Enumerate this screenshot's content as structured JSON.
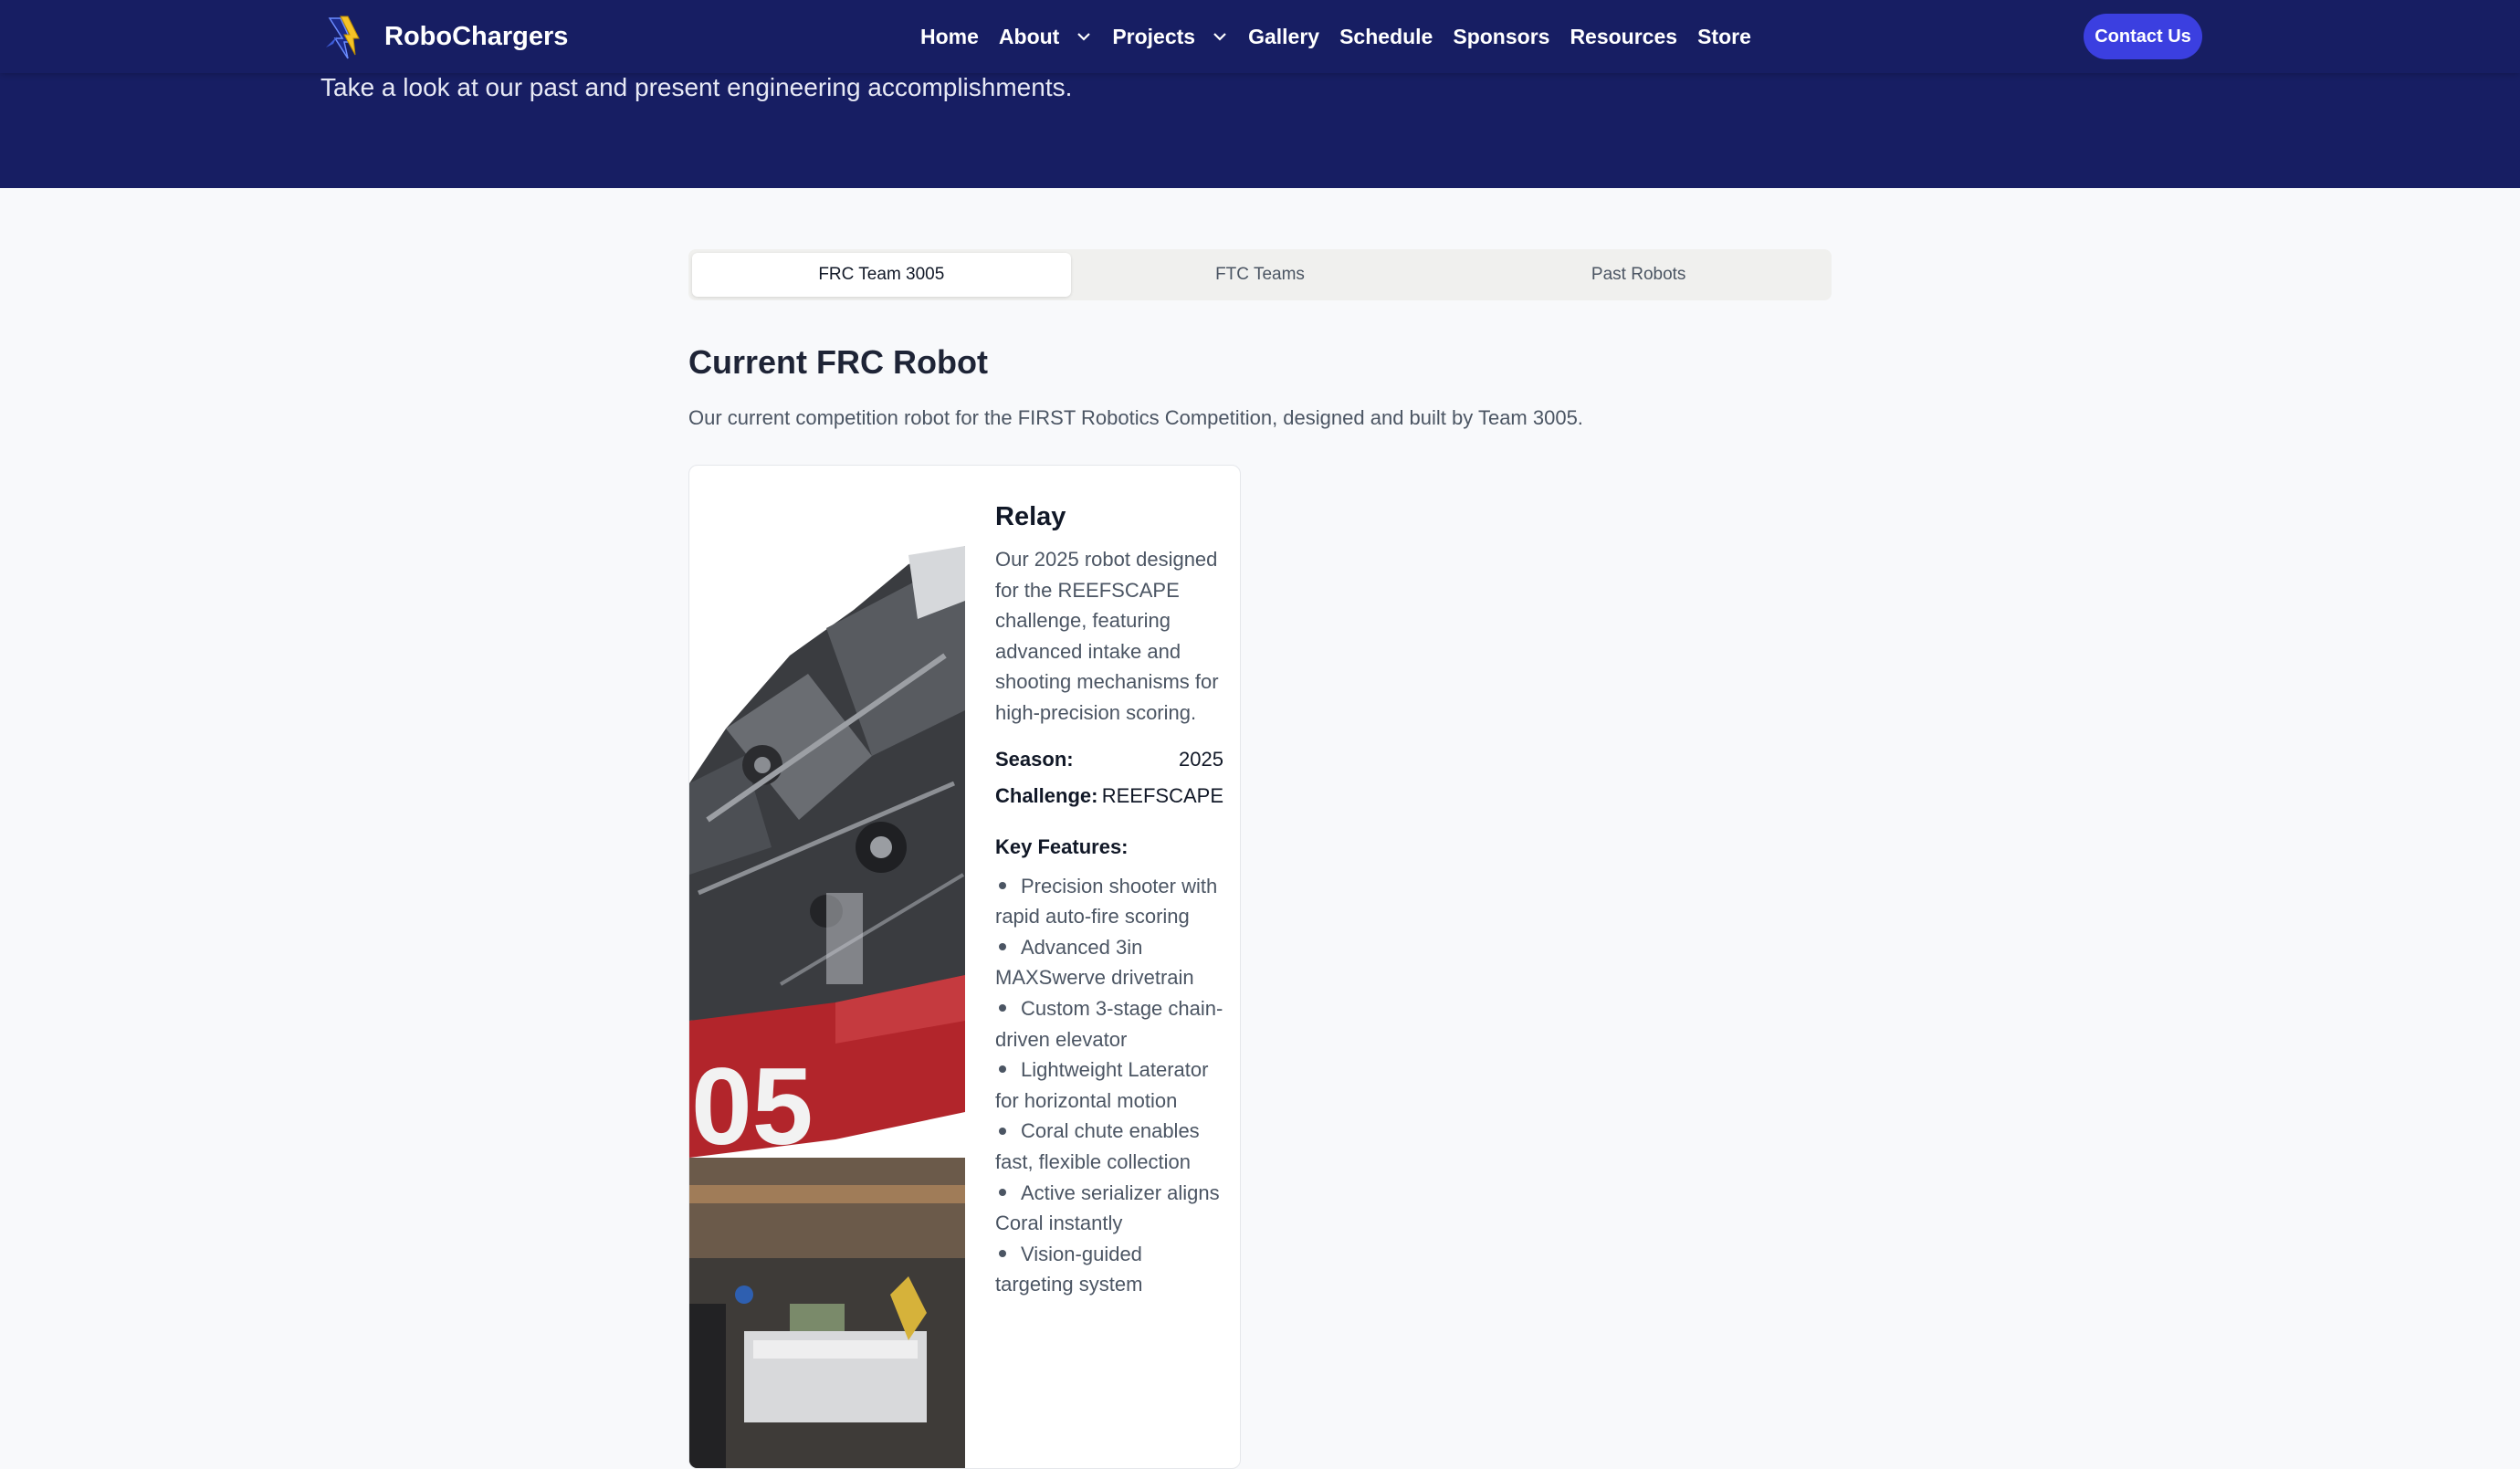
{
  "nav": {
    "brand": "RoboChargers",
    "links": [
      {
        "label": "Home"
      },
      {
        "label": "About",
        "dropdown": true
      },
      {
        "label": "Projects",
        "dropdown": true
      },
      {
        "label": "Gallery"
      },
      {
        "label": "Schedule"
      },
      {
        "label": "Sponsors"
      },
      {
        "label": "Resources"
      },
      {
        "label": "Store"
      }
    ],
    "contact_label": "Contact Us"
  },
  "hero": {
    "subtitle": "Take a look at our past and present engineering accomplishments."
  },
  "tabs": {
    "items": [
      {
        "label": "FRC Team 3005"
      },
      {
        "label": "FTC Teams"
      },
      {
        "label": "Past Robots"
      }
    ],
    "active_index": 0
  },
  "section": {
    "title": "Current FRC Robot",
    "description": "Our current competition robot for the FIRST Robotics Competition, designed and built by Team 3005."
  },
  "robot": {
    "name": "Relay",
    "description": "Our 2025 robot designed for the REEFSCAPE challenge, featuring advanced intake and shooting mechanisms for high-precision scoring.",
    "season_label": "Season:",
    "season_value": "2025",
    "challenge_label": "Challenge:",
    "challenge_value": "REEFSCAPE",
    "features_label": "Key Features:",
    "bumper_number": "05",
    "features": [
      "Precision shooter with rapid auto-fire scoring",
      "Advanced 3in MAXSwerve drivetrain",
      "Custom 3-stage chain-driven elevator",
      "Lightweight Laterator for horizontal motion",
      "Coral chute enables fast, flexible collection",
      "Active serializer aligns Coral instantly",
      "Vision-guided targeting system"
    ]
  },
  "colors": {
    "nav_bg": "#171e63",
    "accent": "#3b3fe0",
    "page_bg": "#f8f9fb",
    "bumper_red": "#b2252b"
  }
}
